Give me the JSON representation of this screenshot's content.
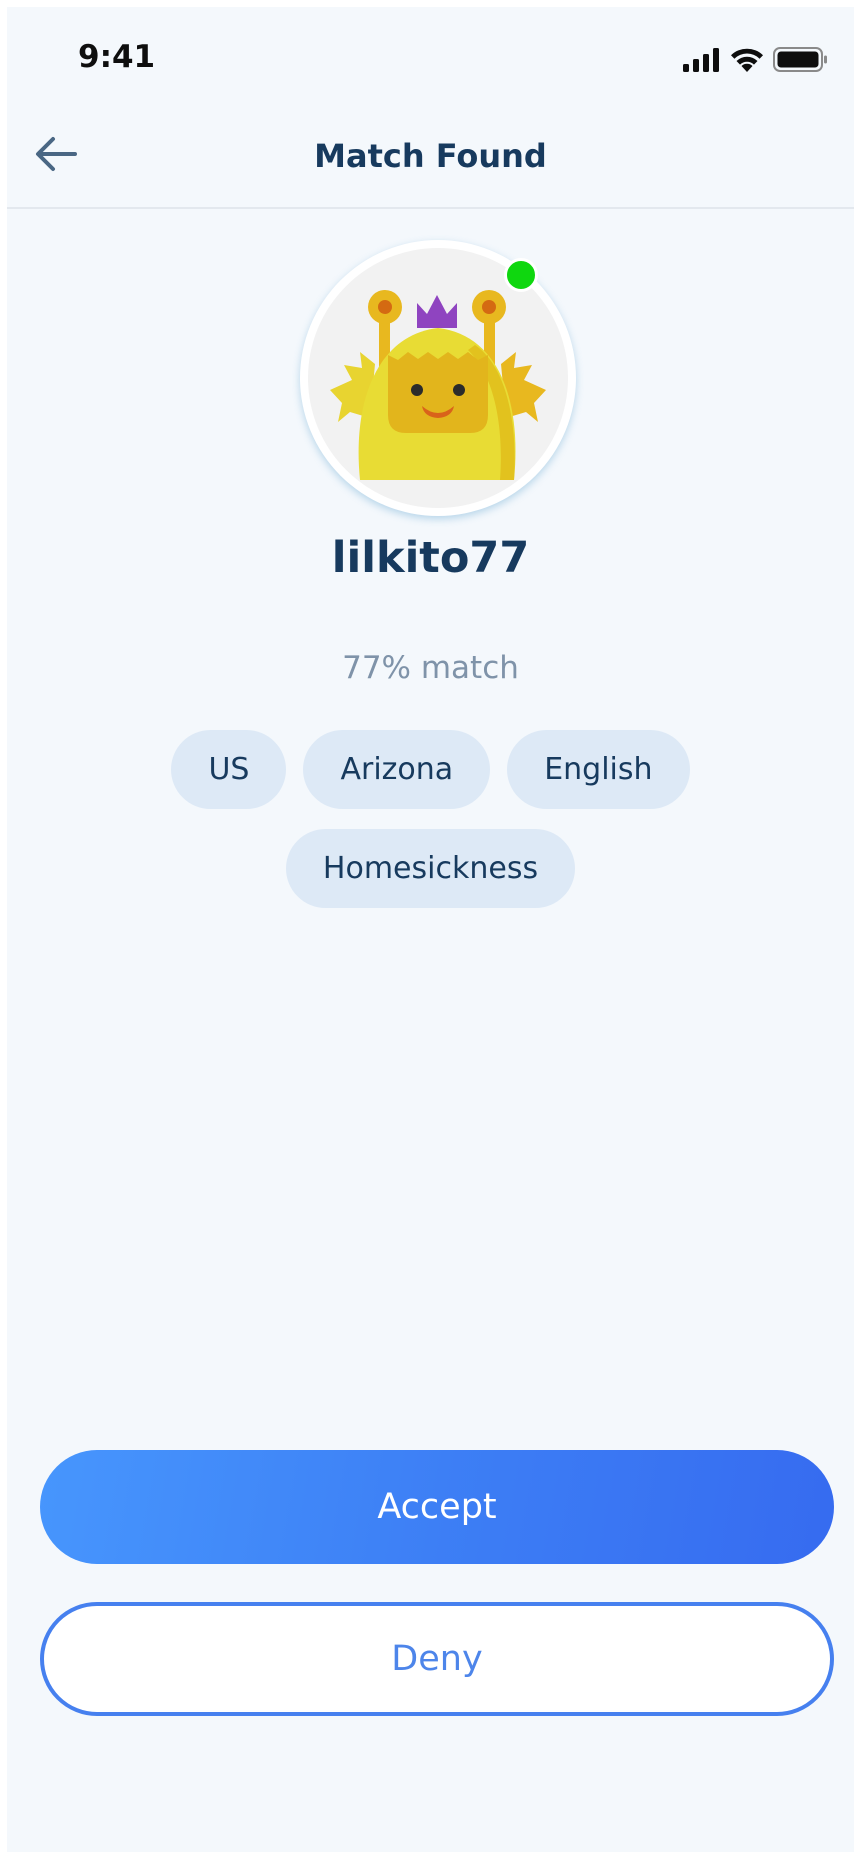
{
  "status_bar": {
    "time": "9:41",
    "icons": [
      "signal-icon",
      "wifi-icon",
      "battery-icon"
    ]
  },
  "header": {
    "back_icon": "arrow-left-icon",
    "title": "Match Found"
  },
  "profile": {
    "avatar": "yellow-monster-avatar",
    "online": true,
    "online_color": "#0fd70f",
    "username": "lilkito77",
    "match_text": "77% match",
    "tags": [
      "US",
      "Arizona",
      "English",
      "Homesickness"
    ]
  },
  "actions": {
    "accept_label": "Accept",
    "deny_label": "Deny"
  },
  "colors": {
    "background": "#f4f8fc",
    "primary_text": "#173a5e",
    "muted_text": "#7f93a9",
    "tag_bg": "#dde9f6",
    "accent_start": "#4796fd",
    "accent_end": "#366bf0"
  }
}
